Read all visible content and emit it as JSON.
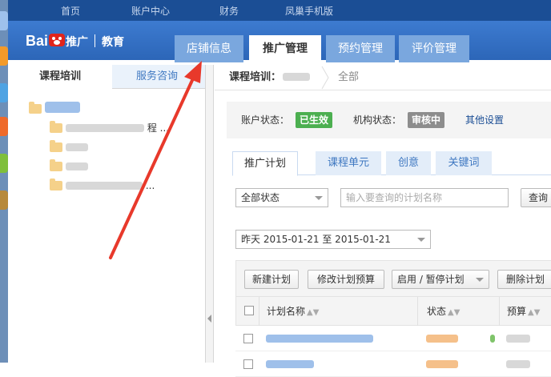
{
  "top_nav": [
    "首页",
    "账户中心",
    "财务",
    "凤巢手机版"
  ],
  "brand": {
    "logo_text": "Bai",
    "logo_text2": "推广",
    "section": "教育"
  },
  "main_tabs": [
    {
      "label": "店铺信息"
    },
    {
      "label": "推广管理"
    },
    {
      "label": "预约管理"
    },
    {
      "label": "评价管理"
    }
  ],
  "left_panel": {
    "tabs": [
      "课程培训",
      "服务咨询"
    ],
    "tree_items": [
      {
        "suffix": ""
      },
      {
        "suffix": "程 ..."
      },
      {
        "suffix": ""
      },
      {
        "suffix": ""
      },
      {
        "suffix": "..."
      }
    ]
  },
  "breadcrumb": {
    "current": "课程培训：",
    "tail": "全部"
  },
  "status_bar": {
    "account_label": "账户状态：",
    "account_value": "已生效",
    "org_label": "机构状态：",
    "org_value": "审核中",
    "other_link": "其他设置"
  },
  "sub_tabs": [
    "推广计划",
    "课程单元",
    "创意",
    "关键词"
  ],
  "filters": {
    "status_select": "全部状态",
    "search_placeholder": "输入要查询的计划名称",
    "search_button": "查询",
    "date_range": "昨天  2015-01-21 至 2015-01-21"
  },
  "toolbar": {
    "new_plan": "新建计划",
    "edit_budget": "修改计划预算",
    "toggle_plan": "启用 / 暂停计划",
    "delete_plan": "删除计划"
  },
  "table": {
    "col_name": "计划名称",
    "col_status": "状态",
    "col_budget": "预算"
  },
  "colors": {
    "primary": "#2c66b8",
    "accent_green": "#4caf50",
    "accent_gray": "#8d8d8d",
    "annotation": "#e8392b"
  }
}
